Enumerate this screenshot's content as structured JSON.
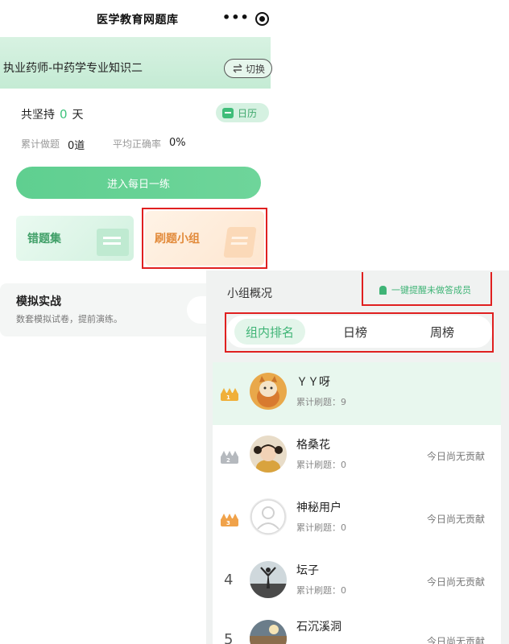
{
  "header": {
    "app_title": "医学教育网题库",
    "more": "•••"
  },
  "course": {
    "name": "执业药师-中药学专业知识二",
    "switch_label": "切换",
    "switch_icon": "swap-arrows-icon"
  },
  "stats": {
    "persist_prefix": "共坚持",
    "persist_days": "0",
    "persist_suffix": "天",
    "calendar_label": "日历",
    "total_label": "累计做题",
    "total_value": "0道",
    "accuracy_label": "平均正确率",
    "accuracy_value": "0%"
  },
  "daily_practice": {
    "label": "进入每日一练"
  },
  "cards": {
    "wrong_set": "错题集",
    "study_group": "刷题小组"
  },
  "mock_exam": {
    "title": "模拟实战",
    "subtitle": "数套模拟试卷，提前演练。"
  },
  "group_panel": {
    "overview_label": "小组概况",
    "remind_label": "一键提醒未做答成员",
    "tabs": [
      "组内排名",
      "日榜",
      "周榜"
    ],
    "active_tab": "组内排名",
    "ranking": [
      {
        "rank": "1",
        "name": "ＹＹ呀",
        "count_label": "累计刷题：9",
        "contribution": ""
      },
      {
        "rank": "2",
        "name": "格桑花",
        "count_label": "累计刷题：0",
        "contribution": "今日尚无贡献"
      },
      {
        "rank": "3",
        "name": "神秘用户",
        "count_label": "累计刷题：0",
        "contribution": "今日尚无贡献"
      },
      {
        "rank": "4",
        "name": "坛子",
        "count_label": "累计刷题：0",
        "contribution": "今日尚无贡献"
      },
      {
        "rank": "5",
        "name": "石沉溪洞",
        "count_label": "",
        "contribution": "今日尚无贡献"
      }
    ]
  },
  "colors": {
    "accent_green": "#3fb476",
    "highlight_red": "#e02020",
    "crown_gold": "#f0b03a",
    "crown_silver": "#b5b9be",
    "crown_bronze": "#f0a24a"
  }
}
